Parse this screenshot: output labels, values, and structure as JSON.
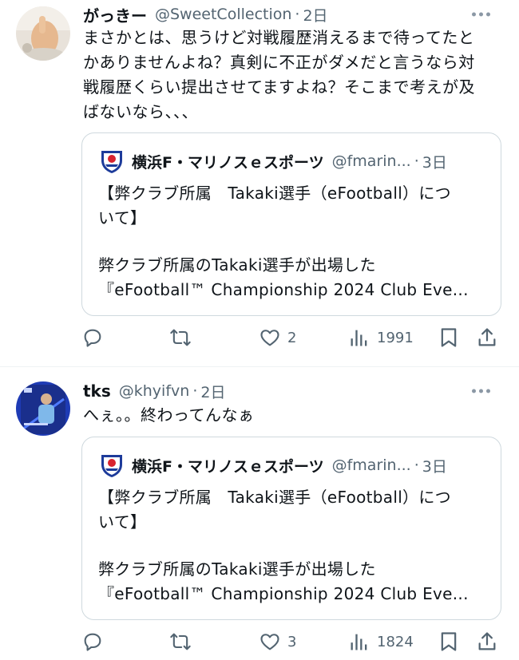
{
  "tweets": [
    {
      "name": "がっきー",
      "handle": "@SweetCollection",
      "dot": "·",
      "time": "2日",
      "text_lines": [
        "まさかとは、思うけど対戦履歴消えるまで待ってたと",
        "かありませんよね？真剣に不正がダメだと言うなら対",
        "戦履歴くらい提出させてますよね？そこまで考えが及",
        "ばないなら、、、"
      ],
      "quote": {
        "name": "横浜F・マリノスｅスポーツ",
        "handle": "@fmarin...",
        "dot": "·",
        "time": "3日",
        "line1": "【弊クラブ所属　Takaki選手（eFootball）につ",
        "line1b": "いて】",
        "line2": "弊クラブ所属のTakaki選手が出場した",
        "line3": "『eFootball™ Championship 2024 Club Eve..."
      },
      "actions": {
        "reply": "",
        "retweet": "",
        "likes": "2",
        "views": "1991"
      }
    },
    {
      "name": "tks",
      "handle": "@khyifvn",
      "dot": "·",
      "time": "2日",
      "text_lines": [
        "へぇ。。終わってんなぁ"
      ],
      "quote": {
        "name": "横浜F・マリノスｅスポーツ",
        "handle": "@fmarin...",
        "dot": "·",
        "time": "3日",
        "line1": "【弊クラブ所属　Takaki選手（eFootball）につ",
        "line1b": "いて】",
        "line2": "弊クラブ所属のTakaki選手が出場した",
        "line3": "『eFootball™ Championship 2024 Club Eve..."
      },
      "actions": {
        "reply": "",
        "retweet": "",
        "likes": "3",
        "views": "1824"
      }
    }
  ],
  "colors": {
    "text": "#0f1419",
    "secondary": "#536471",
    "border": "#cfd9de",
    "marinos_blue": "#1d3b9a",
    "marinos_red": "#d9232e"
  },
  "icons": [
    "reply-icon",
    "retweet-icon",
    "like-icon",
    "views-icon",
    "bookmark-icon",
    "share-icon",
    "more-icon"
  ]
}
